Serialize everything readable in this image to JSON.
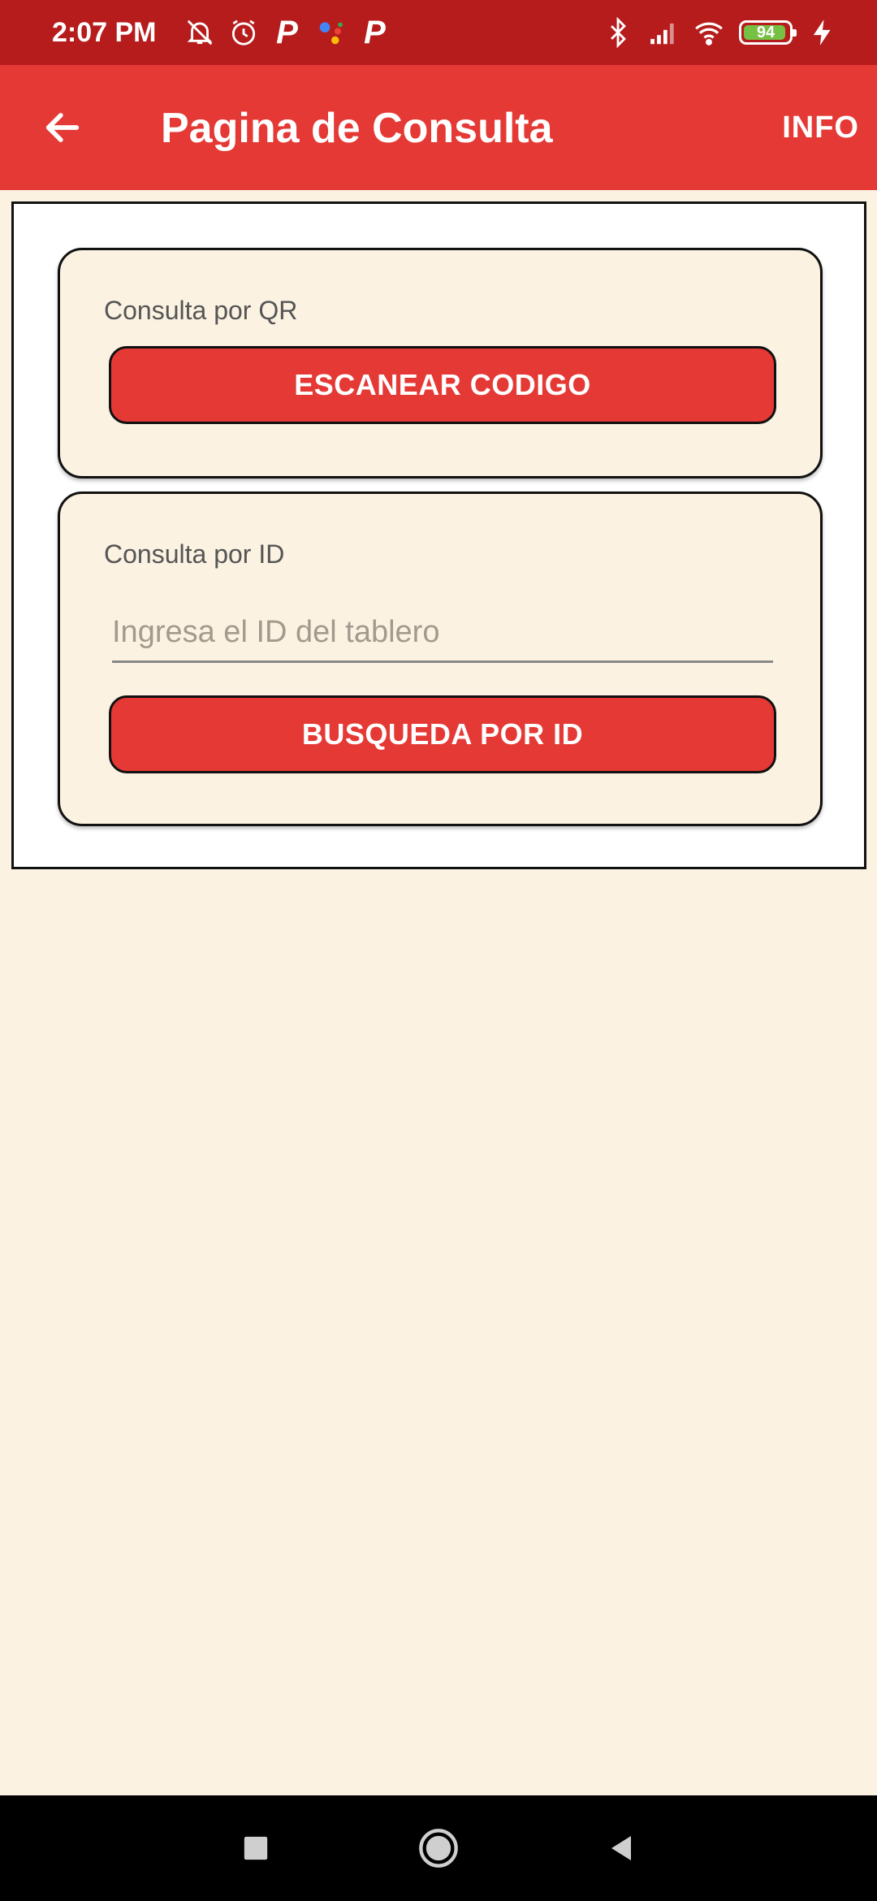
{
  "status_bar": {
    "time": "2:07 PM",
    "left_icons": [
      "mute-notifications-icon",
      "alarm-icon",
      "p-app-icon",
      "assistant-icon",
      "p-app-icon"
    ],
    "right_icons": [
      "bluetooth-icon",
      "signal-icon",
      "wifi-icon",
      "battery-icon",
      "charging-icon"
    ],
    "battery_level": "94",
    "battery_fraction": 0.94,
    "battery_color": "#76C043"
  },
  "app_bar": {
    "title": "Pagina de Consulta",
    "action_label": "INFO",
    "back_icon": "arrow-left-icon",
    "color": "#E53935"
  },
  "qr_section": {
    "label": "Consulta por QR",
    "button_label": "ESCANEAR CODIGO"
  },
  "id_section": {
    "label": "Consulta por ID",
    "input_value": "",
    "input_placeholder": "Ingresa el ID del tablero",
    "button_label": "BUSQUEDA POR ID"
  },
  "nav_bar": {
    "icons": [
      "recent-apps-icon",
      "home-icon",
      "back-icon"
    ]
  },
  "colors": {
    "status_bar": "#B71C1C",
    "accent": "#E53935",
    "background": "#FBF2E2"
  }
}
